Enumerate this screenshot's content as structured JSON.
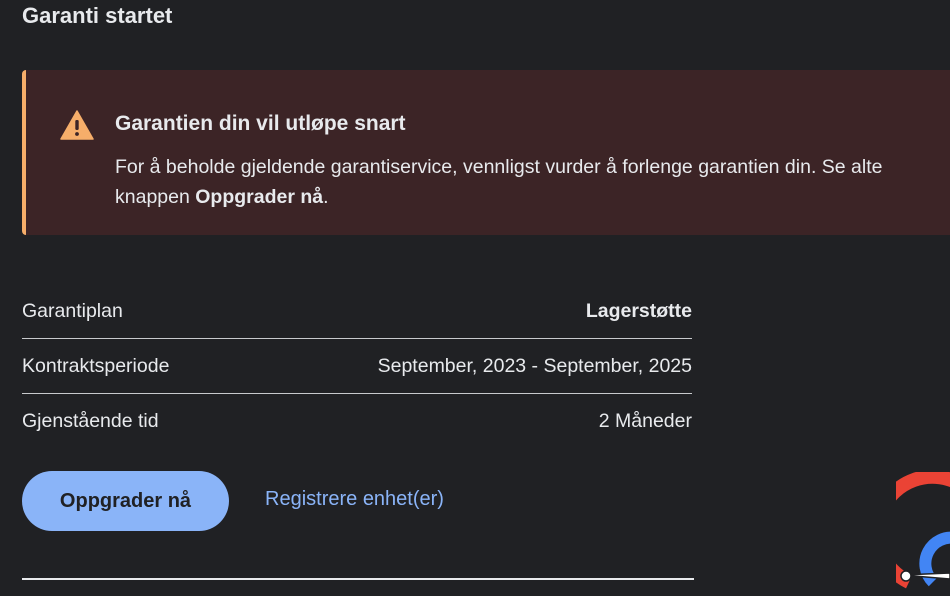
{
  "page": {
    "title": "Garanti startet"
  },
  "alert": {
    "icon": "warning-triangle-icon",
    "heading": "Garantien din vil utløpe snart",
    "body_line1": "For å beholde gjeldende garantiservice, vennligst vurder å forlenge garantien din. Se alte",
    "body_line2_prefix": "knappen ",
    "body_line2_bold": "Oppgrader nå",
    "body_line2_suffix": ".",
    "accent_color": "#f6ae6a",
    "background_color": "#3c2426"
  },
  "info": {
    "rows": [
      {
        "label": "Garantiplan",
        "value": "Lagerstøtte"
      },
      {
        "label": "Kontraktsperiode",
        "value": "September, 2023 - September, 2025"
      },
      {
        "label": "Gjenstående tid",
        "value": "2 Måneder"
      }
    ]
  },
  "actions": {
    "upgrade_label": "Oppgrader nå",
    "register_label": "Registrere enhet(er)"
  },
  "gauge": {
    "icon": "warranty-gauge-icon",
    "colors": [
      "#ea4335",
      "#4285f4"
    ]
  },
  "colors": {
    "background": "#202124",
    "primary": "#8ab4f8",
    "text": "#e8eaed"
  }
}
